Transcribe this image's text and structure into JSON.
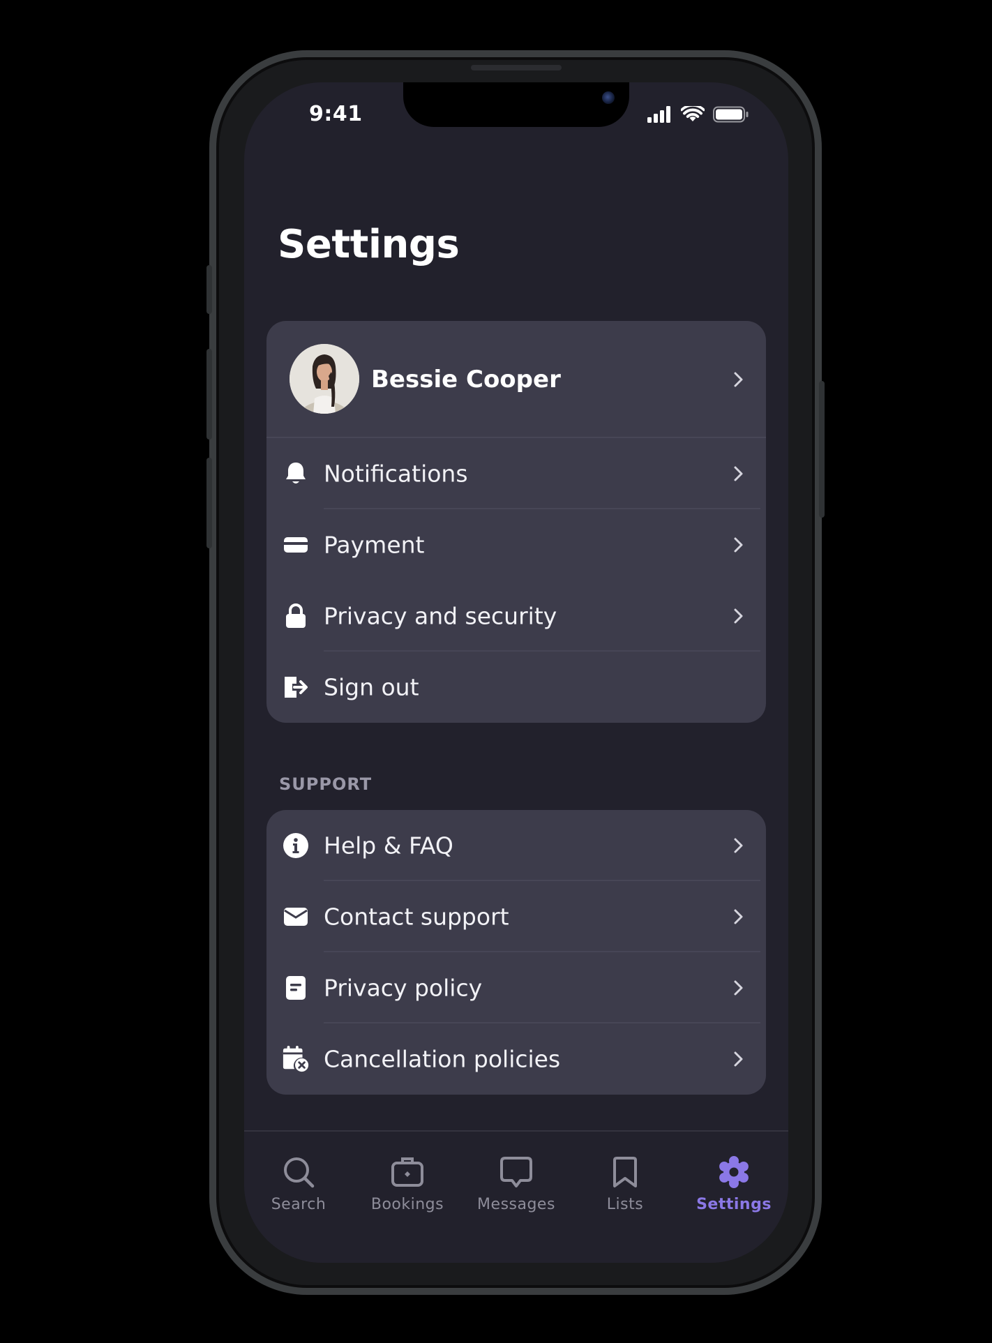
{
  "status_bar": {
    "time": "9:41"
  },
  "page": {
    "title": "Settings"
  },
  "account": {
    "profile": {
      "name": "Bessie Cooper"
    },
    "items": [
      {
        "label": "Notifications",
        "icon": "bell-icon"
      },
      {
        "label": "Payment",
        "icon": "credit-card-icon"
      },
      {
        "label": "Privacy and security",
        "icon": "lock-icon"
      },
      {
        "label": "Sign out",
        "icon": "sign-out-icon"
      }
    ]
  },
  "support": {
    "section_label": "SUPPORT",
    "items": [
      {
        "label": "Help & FAQ",
        "icon": "info-icon"
      },
      {
        "label": "Contact support",
        "icon": "envelope-icon"
      },
      {
        "label": "Privacy policy",
        "icon": "document-icon"
      },
      {
        "label": "Cancellation policies",
        "icon": "calendar-cancel-icon"
      }
    ]
  },
  "tabbar": {
    "active": "Settings",
    "tabs": [
      {
        "label": "Search",
        "icon": "search-icon"
      },
      {
        "label": "Bookings",
        "icon": "suitcase-icon"
      },
      {
        "label": "Messages",
        "icon": "chat-bubble-icon"
      },
      {
        "label": "Lists",
        "icon": "bookmark-icon"
      },
      {
        "label": "Settings",
        "icon": "gear-icon"
      }
    ]
  },
  "colors": {
    "background": "#22212c",
    "card": "#3d3c4b",
    "accent": "#8b78e6",
    "inactive_tab": "#8e8d9a"
  }
}
